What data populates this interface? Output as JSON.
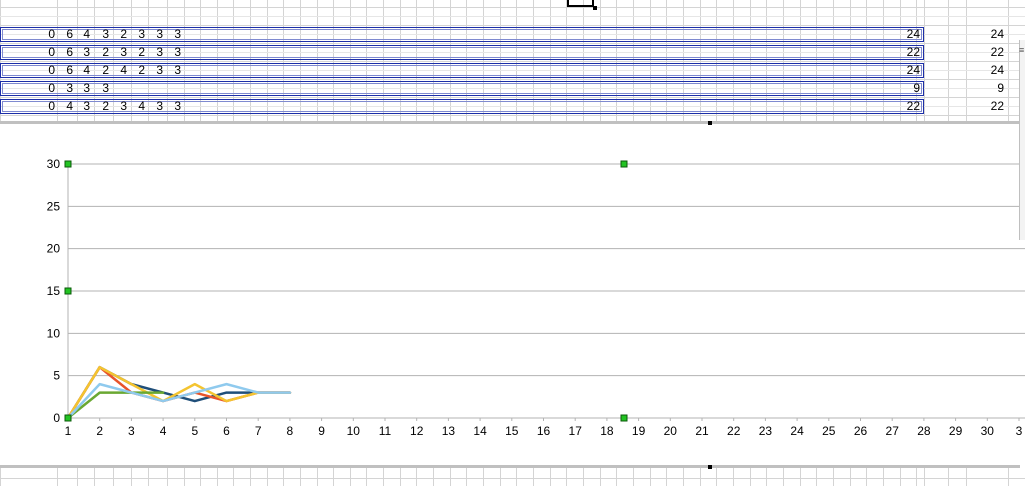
{
  "sheet": {
    "rows": [
      {
        "cells": [
          "0",
          "6",
          "4",
          "3",
          "2",
          "3",
          "3",
          "3"
        ],
        "total": "24",
        "right": "24"
      },
      {
        "cells": [
          "0",
          "6",
          "3",
          "2",
          "3",
          "2",
          "3",
          "3"
        ],
        "total": "22",
        "right": "22"
      },
      {
        "cells": [
          "0",
          "6",
          "4",
          "2",
          "4",
          "2",
          "3",
          "3"
        ],
        "total": "24",
        "right": "24"
      },
      {
        "cells": [
          "0",
          "3",
          "3",
          "3",
          "",
          "",
          "",
          ""
        ],
        "total": "9",
        "right": "9"
      },
      {
        "cells": [
          "0",
          "4",
          "3",
          "2",
          "3",
          "4",
          "3",
          "3"
        ],
        "total": "22",
        "right": "22"
      }
    ]
  },
  "chart_data": {
    "type": "line",
    "x": [
      1,
      2,
      3,
      4,
      5,
      6,
      7,
      8
    ],
    "xticks": [
      "1",
      "2",
      "3",
      "4",
      "5",
      "6",
      "7",
      "8",
      "9",
      "10",
      "11",
      "12",
      "13",
      "14",
      "15",
      "16",
      "17",
      "18",
      "19",
      "20",
      "21",
      "22",
      "23",
      "24",
      "25",
      "26",
      "27",
      "28",
      "29",
      "30",
      "3"
    ],
    "xlim": [
      1,
      31
    ],
    "yticks": [
      "0",
      "5",
      "10",
      "15",
      "20",
      "25",
      "30"
    ],
    "ylim": [
      0,
      30
    ],
    "grid": true,
    "series": [
      {
        "values": [
          0,
          6,
          4,
          3,
          2,
          3,
          3,
          3
        ],
        "color": "#1f4e79"
      },
      {
        "values": [
          0,
          6,
          3,
          2,
          3,
          2,
          3,
          3
        ],
        "color": "#e8542a"
      },
      {
        "values": [
          0,
          6,
          4,
          2,
          4,
          2,
          3,
          3
        ],
        "color": "#f4c430"
      },
      {
        "values": [
          0,
          3,
          3,
          3
        ],
        "color": "#6aa832"
      },
      {
        "values": [
          0,
          4,
          3,
          2,
          3,
          4,
          3,
          3
        ],
        "color": "#8fcaee"
      }
    ]
  }
}
